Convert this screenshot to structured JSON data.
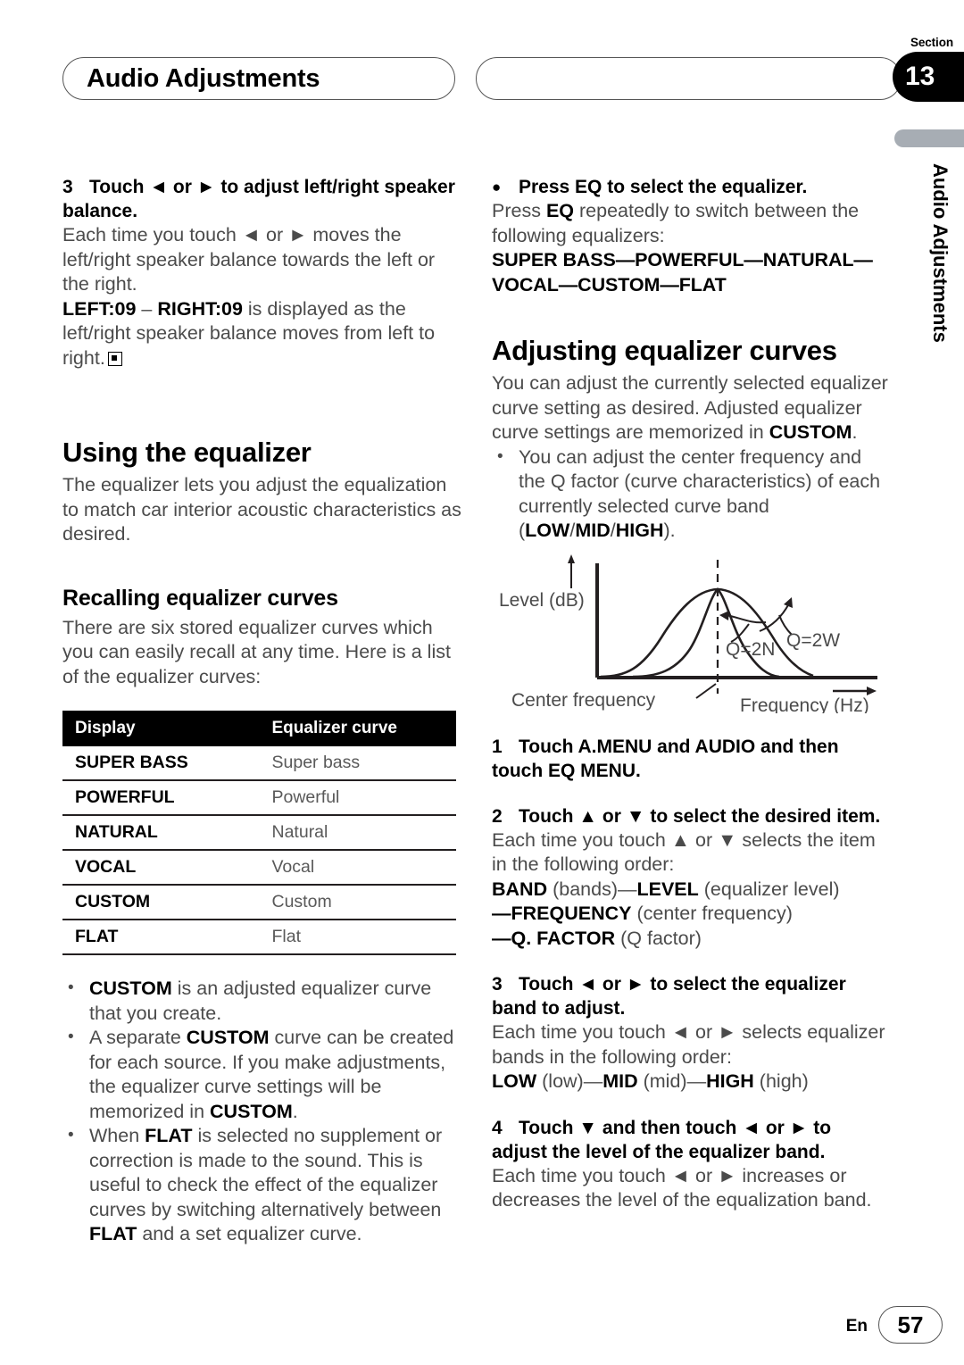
{
  "header": {
    "left_title": "Audio Adjustments",
    "right_title": "",
    "section_label": "Section",
    "section_number": "13"
  },
  "side_tab": {
    "label": "Audio Adjustments"
  },
  "left_column": {
    "step3": {
      "number": "3",
      "text": "Touch ◄ or ► to adjust left/right speaker balance.",
      "body1": "Each time you touch ◄ or ► moves the left/right speaker balance towards the left or the right.",
      "body2_bold1": "LEFT:09",
      "body2_dash": " – ",
      "body2_bold2": "RIGHT:09",
      "body2_rest": " is displayed as the left/right speaker balance moves from left to right."
    },
    "using_heading": "Using the equalizer",
    "using_body": "The equalizer lets you adjust the equalization to match car interior acoustic characteristics as desired.",
    "recalling_heading": "Recalling equalizer curves",
    "recalling_body": "There are six stored equalizer curves which you can easily recall at any time. Here is a list of the equalizer curves:",
    "table": {
      "columns": [
        "Display",
        "Equalizer curve"
      ],
      "rows": [
        {
          "display": "SUPER BASS",
          "curve": "Super bass"
        },
        {
          "display": "POWERFUL",
          "curve": "Powerful"
        },
        {
          "display": "NATURAL",
          "curve": "Natural"
        },
        {
          "display": "VOCAL",
          "curve": "Vocal"
        },
        {
          "display": "CUSTOM",
          "curve": "Custom"
        },
        {
          "display": "FLAT",
          "curve": "Flat"
        }
      ]
    },
    "notes": [
      {
        "parts": [
          {
            "b": "CUSTOM"
          },
          {
            "t": " is an adjusted equalizer curve that you create."
          }
        ]
      },
      {
        "parts": [
          {
            "t": "A separate "
          },
          {
            "b": "CUSTOM"
          },
          {
            "t": " curve can be created for each source. If you make adjustments, the equalizer curve settings will be memorized in "
          },
          {
            "b": "CUSTOM"
          },
          {
            "t": "."
          }
        ]
      },
      {
        "parts": [
          {
            "t": "When "
          },
          {
            "b": "FLAT"
          },
          {
            "t": " is selected no supplement or correction is made to the sound. This is useful to check the effect of the equalizer curves by switching alternatively between "
          },
          {
            "b": "FLAT"
          },
          {
            "t": " and a set equalizer curve."
          }
        ]
      }
    ]
  },
  "right_column": {
    "eq_bullet": {
      "marker": "●",
      "heading": "Press EQ to select the equalizer.",
      "body_pre": "Press ",
      "body_bold": "EQ",
      "body_post": " repeatedly to switch between the following equalizers:",
      "sequence_line1": "SUPER BASS—POWERFUL—NATURAL—",
      "sequence_line2": "VOCAL—CUSTOM—FLAT"
    },
    "adjusting_heading": "Adjusting equalizer curves",
    "adjusting_body_pre": "You can adjust the currently selected equalizer curve setting as desired. Adjusted equalizer curve settings are memorized in ",
    "adjusting_body_bold": "CUSTOM",
    "adjusting_body_post": ".",
    "adjusting_note": {
      "pre": "You can adjust the center frequency and the Q factor (curve characteristics) of each currently selected curve band (",
      "b1": "LOW",
      "s1": "/",
      "b2": "MID",
      "s2": "/",
      "b3": "HIGH",
      "post": ")."
    },
    "step1": {
      "number": "1",
      "text": "Touch A.MENU and AUDIO and then touch EQ MENU."
    },
    "step2": {
      "number": "2",
      "text": "Touch ▲ or ▼ to select the desired item.",
      "body": "Each time you touch ▲ or ▼ selects the item in the following order:",
      "order_l1_b1": "BAND",
      "order_l1_t1": " (bands)—",
      "order_l1_b2": "LEVEL",
      "order_l1_t2": " (equalizer level)",
      "order_l2_b1": "—FREQUENCY",
      "order_l2_t1": " (center frequency)",
      "order_l3_b1": "—Q. FACTOR",
      "order_l3_t1": " (Q factor)"
    },
    "step3": {
      "number": "3",
      "text": "Touch ◄ or ► to select the equalizer band to adjust.",
      "body": "Each time you touch ◄ or ► selects equalizer bands in the following order:",
      "order_b1": "LOW",
      "order_t1": " (low)—",
      "order_b2": "MID",
      "order_t2": " (mid)—",
      "order_b3": "HIGH",
      "order_t3": " (high)"
    },
    "step4": {
      "number": "4",
      "text": "Touch ▼ and then touch ◄ or ► to adjust the level of the equalizer band.",
      "body": "Each time you touch ◄ or ► increases or decreases the level of the equalization band."
    }
  },
  "chart_data": {
    "type": "line",
    "title": "",
    "xlabel": "Frequency (Hz)",
    "ylabel": "Level (dB)",
    "annotations": [
      {
        "text": "Q=2N",
        "meaning": "narrow-q-curve-label"
      },
      {
        "text": "Q=2W",
        "meaning": "wide-q-curve-label"
      },
      {
        "text": "Center frequency",
        "meaning": "dashed-vertical-line-label"
      }
    ],
    "series": [
      {
        "name": "Q=2W",
        "description": "wide bell curve peaking at center frequency"
      },
      {
        "name": "Q=2N",
        "description": "narrow bell curve peaking at center frequency"
      }
    ],
    "grid": false,
    "legend": "inline-annotations"
  },
  "footer": {
    "language": "En",
    "page_number": "57"
  }
}
